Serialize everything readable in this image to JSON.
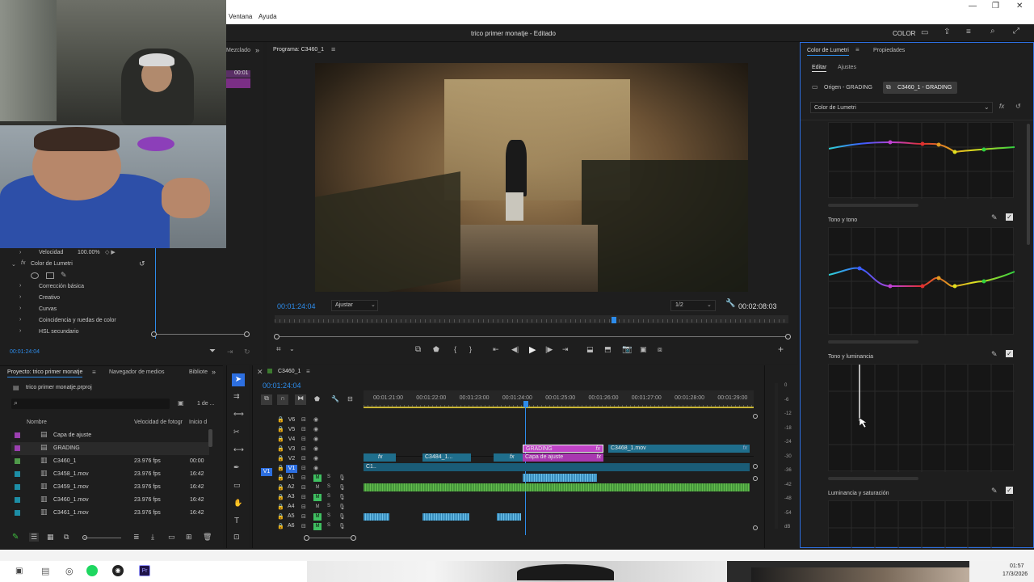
{
  "menubar": {
    "items": [
      "Ventana",
      "Ayuda"
    ]
  },
  "window": {
    "title": "trico primer monatje - Editado",
    "workspace": "COLOR",
    "controls": [
      "—",
      "❐",
      "✕"
    ]
  },
  "effect_controls": {
    "tab_left": "Mezclado",
    "timecode_small": "00:01",
    "velocidad_label": "Velocidad",
    "velocidad_value": "100.00%",
    "lumetri_label": "Color de Lumetri",
    "sections": [
      "Corrección básica",
      "Creativo",
      "Curvas",
      "Coincidencia y ruedas de color",
      "HSL secundario"
    ],
    "timecode": "00:01:24:04"
  },
  "program": {
    "title": "Programa: C3460_1",
    "timecode": "00:01:24:04",
    "fit": "Ajustar",
    "quality": "1/2",
    "duration": "00:02:08:03",
    "playhead_fraction": 0.66
  },
  "project": {
    "tabs": [
      "Proyecto: trico primer monatje",
      "Navegador de medios",
      "Bibliote"
    ],
    "file": "trico primer monatje.prproj",
    "count": "1 de ...",
    "search_placeholder": "",
    "columns": [
      "Nombre",
      "Velocidad de fotogr",
      "Inicio d"
    ],
    "rows": [
      {
        "name": "Capa de ajuste",
        "fps": "",
        "start": "",
        "color": "#9b3fb0"
      },
      {
        "name": "GRADING",
        "fps": "",
        "start": "",
        "color": "#9b3fb0"
      },
      {
        "name": "C3460_1",
        "fps": "23.976 fps",
        "start": "00:00",
        "color": "#4f9a4a"
      },
      {
        "name": "C3458_1.mov",
        "fps": "23.976 fps",
        "start": "16:42",
        "color": "#1d8ea6"
      },
      {
        "name": "C3459_1.mov",
        "fps": "23.976 fps",
        "start": "16:42",
        "color": "#1d8ea6"
      },
      {
        "name": "C3460_1.mov",
        "fps": "23.976 fps",
        "start": "16:42",
        "color": "#1d8ea6"
      },
      {
        "name": "C3461_1.mov",
        "fps": "23.976 fps",
        "start": "16:42",
        "color": "#1d8ea6"
      }
    ]
  },
  "timeline": {
    "tab": "C3460_1",
    "timecode": "00:01:24:04",
    "ruler": [
      "00:01:21:00",
      "00:01:22:00",
      "00:01:23:00",
      "00:01:24:00",
      "00:01:25:00",
      "00:01:26:00",
      "00:01:27:00",
      "00:01:28:00",
      "00:01:29:00"
    ],
    "video_tracks": [
      "V6",
      "V5",
      "V4",
      "V3",
      "V2",
      "V1"
    ],
    "audio_tracks": [
      "A1",
      "A2",
      "A3",
      "A4",
      "A5",
      "A6"
    ],
    "clips": {
      "grading": "GRADING",
      "capa": "Capa de ajuste",
      "c3468": "C3468_1.mov",
      "c3484": "C3484_1...",
      "c1": "C1..",
      "fx": "fx"
    },
    "meter_labels": [
      "0",
      "-6",
      "-12",
      "-18",
      "-24",
      "-30",
      "-36",
      "-42",
      "-48",
      "-54",
      "dB"
    ]
  },
  "lumetri": {
    "tabs": [
      "Color de Lumetri",
      "Propiedades"
    ],
    "subtabs": [
      "Editar",
      "Ajustes"
    ],
    "origin": "Origen - GRADING",
    "target": "C3460_1 - GRADING",
    "effect_select": "Color de Lumetri",
    "curves": [
      "Tono y tono",
      "Tono y luminancia",
      "Luminancia y saturación"
    ]
  },
  "taskbar": {
    "time": "01:57",
    "date": "17/3/2026"
  }
}
